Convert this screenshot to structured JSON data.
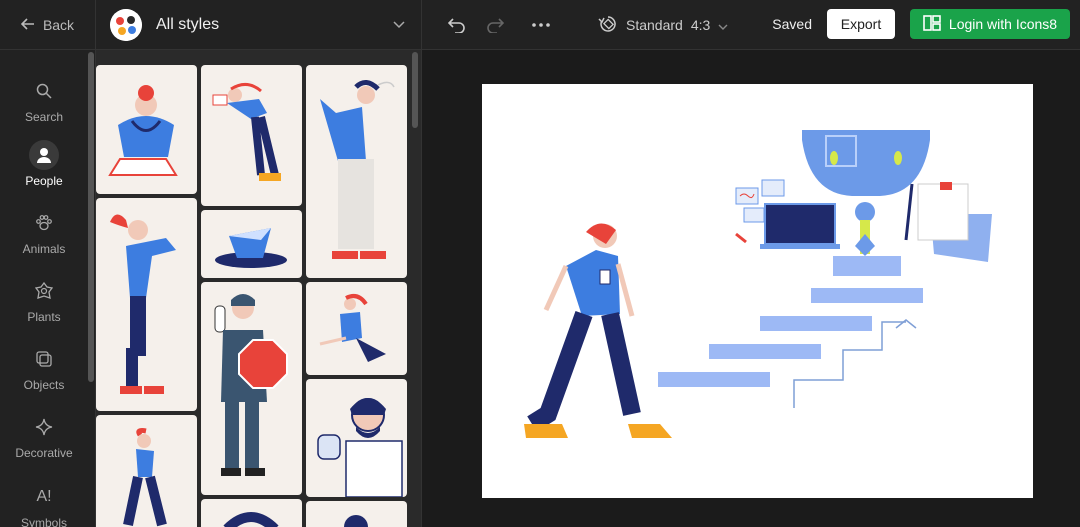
{
  "header": {
    "back_label": "Back",
    "styles_title": "All styles",
    "ratio_label": "Standard",
    "ratio_value": "4:3",
    "saved_label": "Saved",
    "export_label": "Export",
    "login_label": "Login with Icons8"
  },
  "rail": {
    "items": [
      {
        "label": "Search",
        "icon": "search-icon"
      },
      {
        "label": "People",
        "icon": "person-icon"
      },
      {
        "label": "Animals",
        "icon": "paw-icon"
      },
      {
        "label": "Plants",
        "icon": "flower-icon"
      },
      {
        "label": "Objects",
        "icon": "objects-icon"
      },
      {
        "label": "Decorative",
        "icon": "sparkle-icon"
      },
      {
        "label": "Symbols",
        "icon": "symbols-icon"
      }
    ]
  },
  "colors": {
    "accent_green": "#1aa34a",
    "illustration_blue": "#3d7de0",
    "illustration_navy": "#1f2a6b",
    "illustration_red": "#e8433a",
    "illustration_orange": "#f5a623"
  }
}
